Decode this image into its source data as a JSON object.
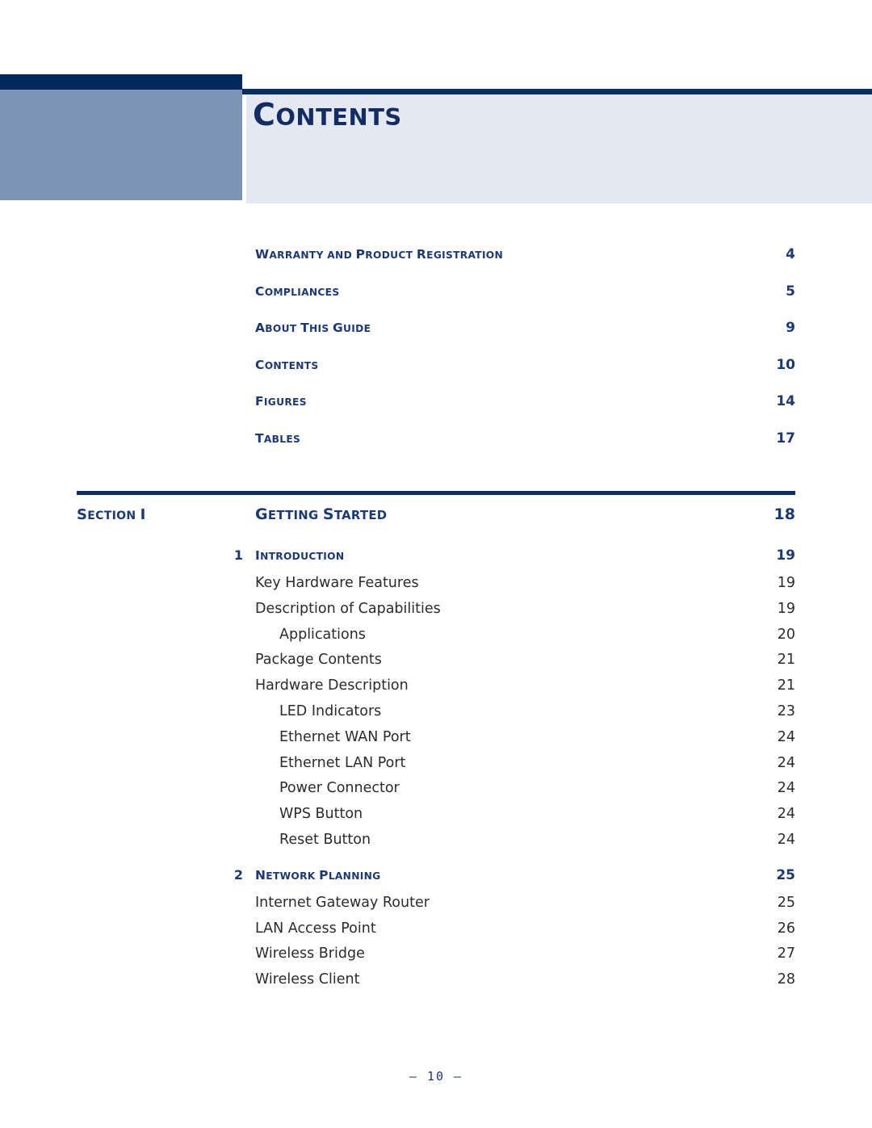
{
  "header": {
    "title_first": "C",
    "title_rest": "ONTENTS"
  },
  "frontmatter": [
    {
      "label_first": "W",
      "label_rest": "ARRANTY AND ",
      "label_first2": "P",
      "label_rest2": "RODUCT ",
      "label_first3": "R",
      "label_rest3": "EGISTRATION",
      "full": "Warranty and Product Registration",
      "page": "4"
    },
    {
      "label_first": "C",
      "label_rest": "OMPLIANCES",
      "full": "Compliances",
      "page": "5"
    },
    {
      "label_first": "A",
      "label_rest": "BOUT ",
      "label_first2": "T",
      "label_rest2": "HIS ",
      "label_first3": "G",
      "label_rest3": "UIDE",
      "full": "About This Guide",
      "page": "9"
    },
    {
      "label_first": "C",
      "label_rest": "ONTENTS",
      "full": "Contents",
      "page": "10"
    },
    {
      "label_first": "F",
      "label_rest": "IGURES",
      "full": "Figures",
      "page": "14"
    },
    {
      "label_first": "T",
      "label_rest": "ABLES",
      "full": "Tables",
      "page": "17"
    }
  ],
  "section": {
    "name_first": "S",
    "name_rest": "ECTION ",
    "name_roman": "I",
    "title_first": "G",
    "title_rest": "ETTING ",
    "title_first2": "S",
    "title_rest2": "TARTED",
    "page": "18"
  },
  "toc": [
    {
      "level": "chapter",
      "num": "1",
      "text_first": "I",
      "text_rest": "NTRODUCTION",
      "text": "Introduction",
      "page": "19"
    },
    {
      "level": "lvl1",
      "num": "",
      "text": "Key Hardware Features",
      "page": "19"
    },
    {
      "level": "lvl1",
      "num": "",
      "text": "Description of Capabilities",
      "page": "19"
    },
    {
      "level": "lvl2",
      "num": "",
      "text": "Applications",
      "page": "20"
    },
    {
      "level": "lvl1",
      "num": "",
      "text": "Package Contents",
      "page": "21"
    },
    {
      "level": "lvl1",
      "num": "",
      "text": "Hardware Description",
      "page": "21"
    },
    {
      "level": "lvl2",
      "num": "",
      "text": "LED Indicators",
      "page": "23"
    },
    {
      "level": "lvl2",
      "num": "",
      "text": "Ethernet WAN Port",
      "page": "24"
    },
    {
      "level": "lvl2",
      "num": "",
      "text": "Ethernet LAN Port",
      "page": "24"
    },
    {
      "level": "lvl2",
      "num": "",
      "text": "Power Connector",
      "page": "24"
    },
    {
      "level": "lvl2",
      "num": "",
      "text": "WPS Button",
      "page": "24"
    },
    {
      "level": "lvl2",
      "num": "",
      "text": "Reset Button",
      "page": "24"
    },
    {
      "level": "chapter",
      "num": "2",
      "text_first": "N",
      "text_rest": "ETWORK ",
      "text_first2": "P",
      "text_rest2": "LANNING",
      "text": "Network Planning",
      "page": "25",
      "gap": true
    },
    {
      "level": "lvl1",
      "num": "",
      "text": "Internet Gateway Router",
      "page": "25"
    },
    {
      "level": "lvl1",
      "num": "",
      "text": "LAN Access Point",
      "page": "26"
    },
    {
      "level": "lvl1",
      "num": "",
      "text": "Wireless Bridge",
      "page": "27"
    },
    {
      "level": "lvl1",
      "num": "",
      "text": "Wireless Client",
      "page": "28"
    }
  ],
  "footer": {
    "page_marker": "–  10  –"
  },
  "colors": {
    "navy_dark": "#002a5e",
    "navy_rule": "#042f63",
    "slate_block": "#7d94b7",
    "panel_bg": "#e4e8f0",
    "heading_blue": "#1b3a75",
    "body_text": "#2b2b2b"
  }
}
